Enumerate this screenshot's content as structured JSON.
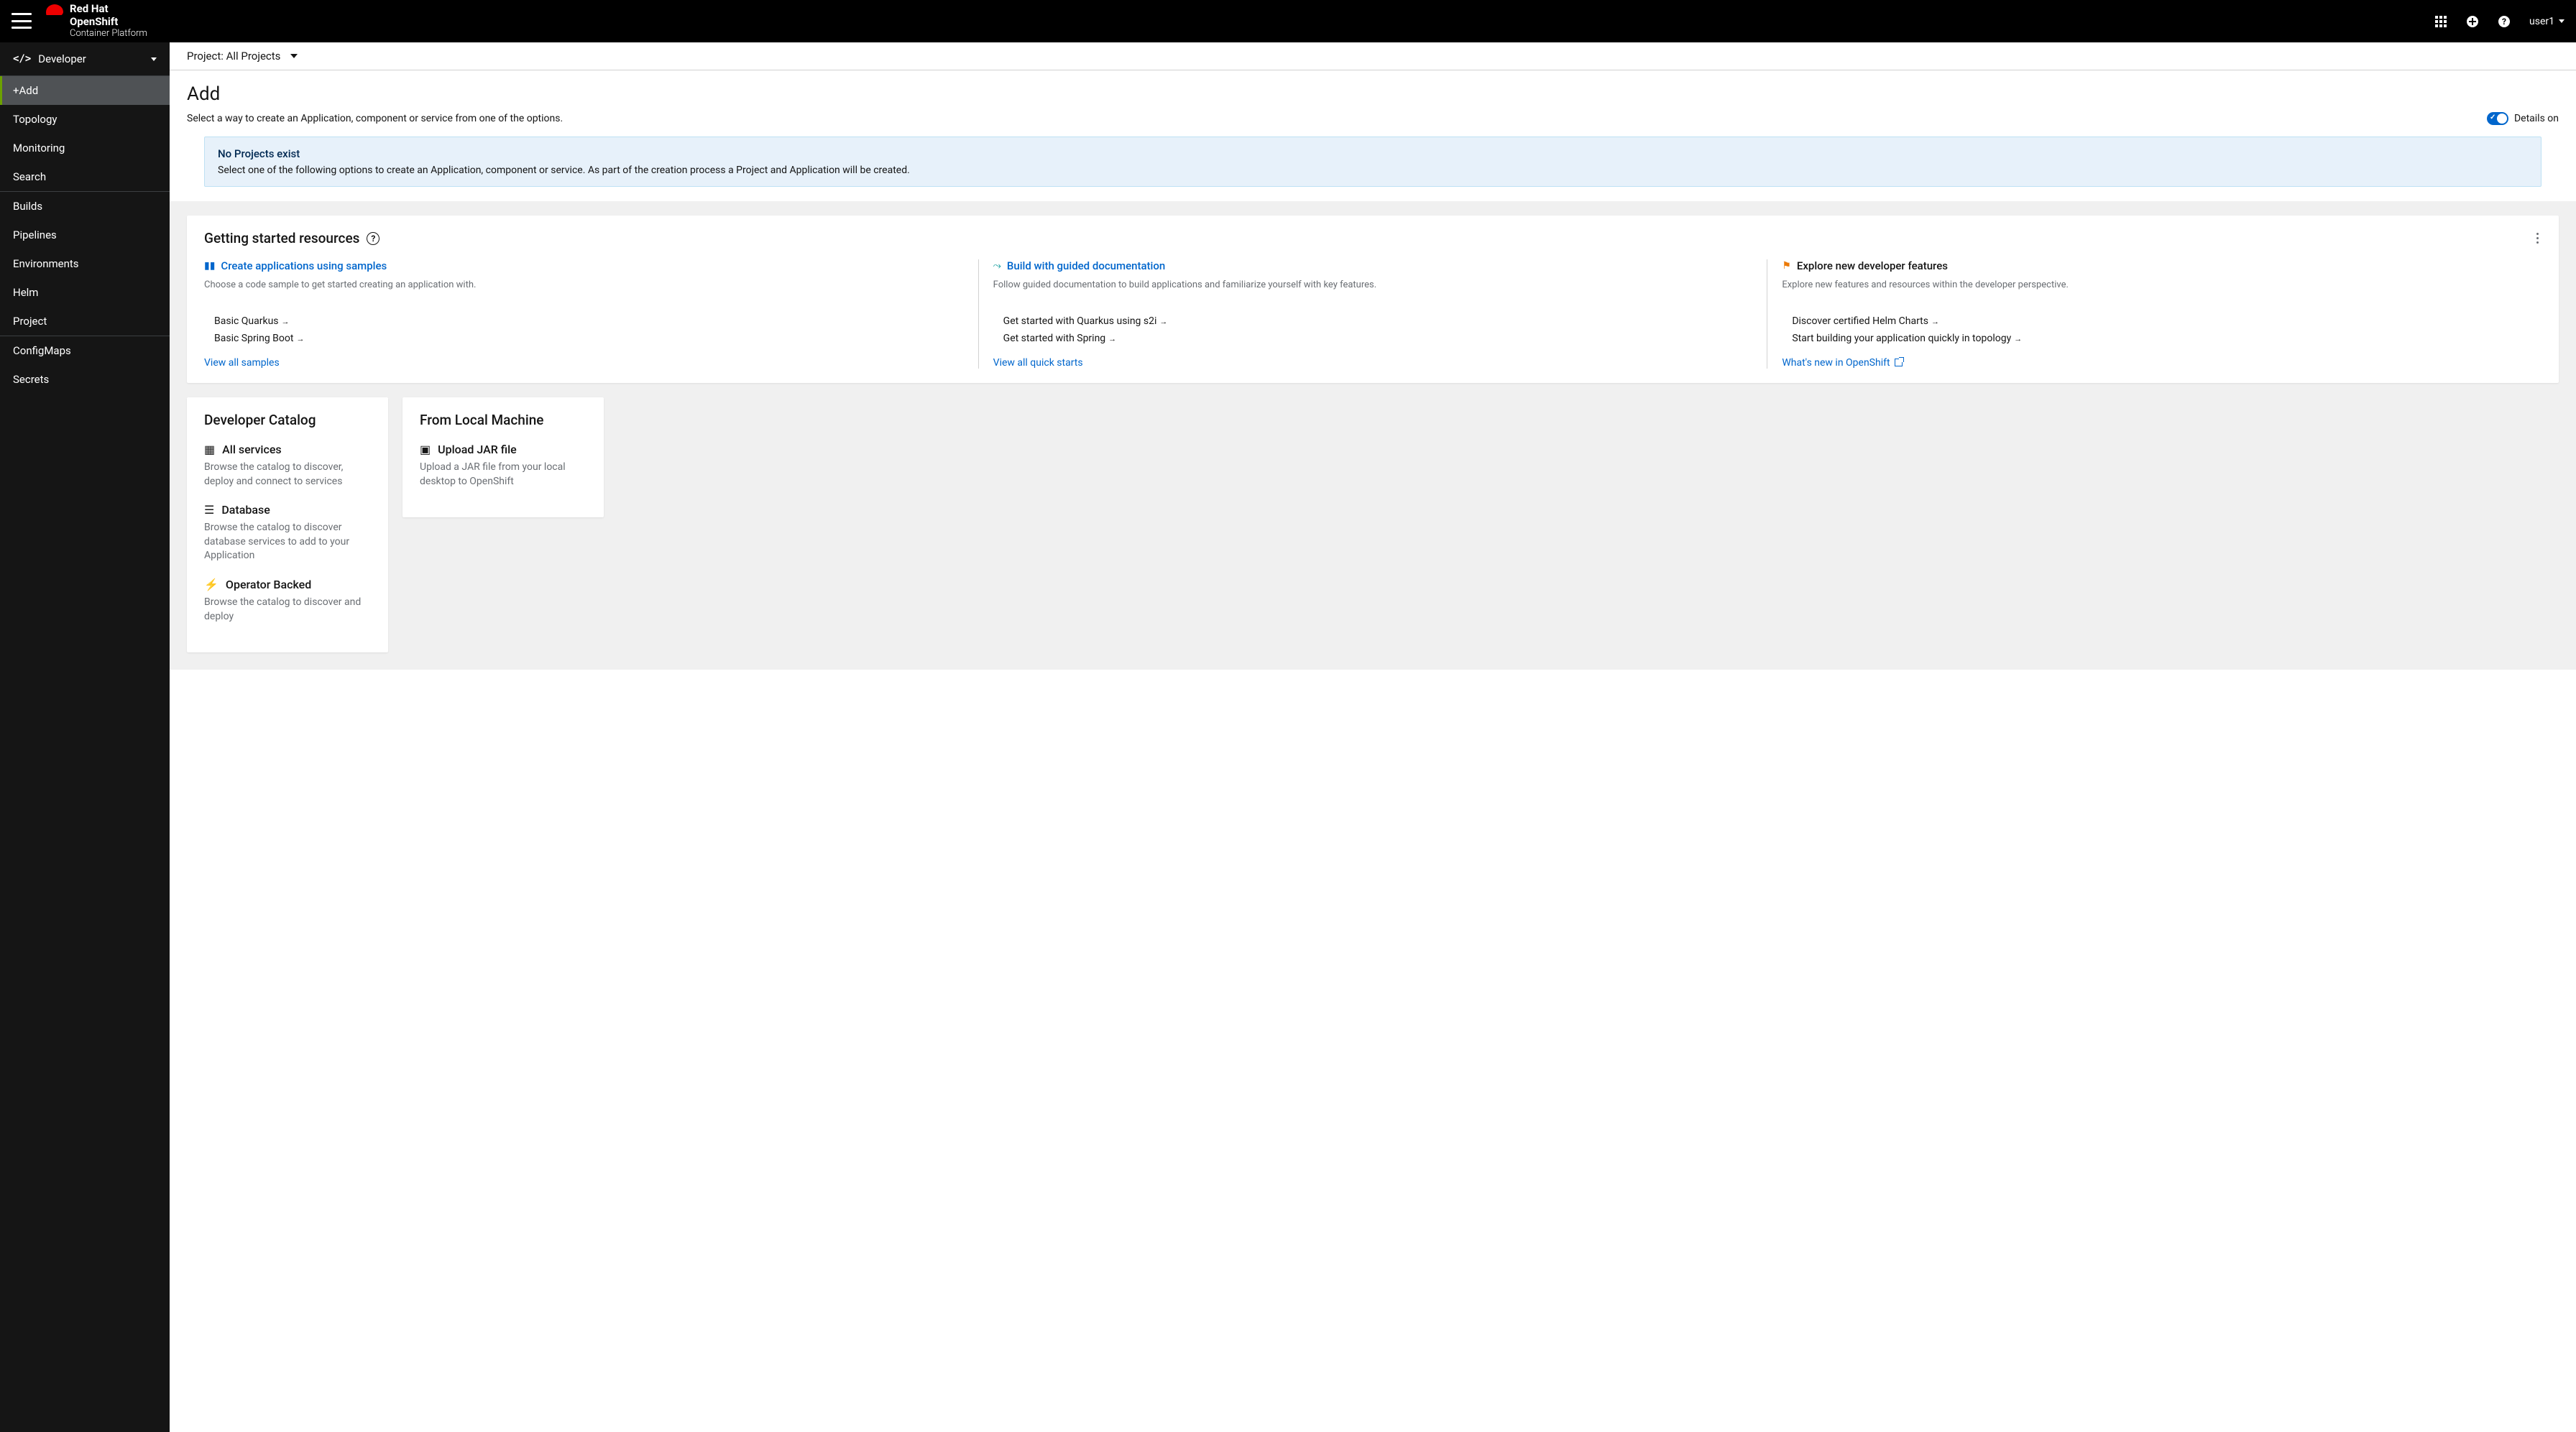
{
  "brand": {
    "line1": "Red Hat",
    "line2": "OpenShift",
    "line3": "Container Platform"
  },
  "user": "user1",
  "perspective": "Developer",
  "nav": {
    "group1": [
      "+Add",
      "Topology",
      "Monitoring",
      "Search"
    ],
    "group2": [
      "Builds",
      "Pipelines",
      "Environments",
      "Helm",
      "Project"
    ],
    "group3": [
      "ConfigMaps",
      "Secrets"
    ]
  },
  "project_selector": "Project: All Projects",
  "page": {
    "title": "Add",
    "subtitle": "Select a way to create an Application, component or service from one of the options."
  },
  "details_label": "Details on",
  "alert": {
    "title": "No Projects exist",
    "body": "Select one of the following options to create an Application, component or service. As part of the creation process a Project and Application will be created."
  },
  "gsr": {
    "title": "Getting started resources",
    "cols": [
      {
        "title": "Create applications using samples",
        "desc": "Choose a code sample to get started creating an application with.",
        "links": [
          "Basic Quarkus",
          "Basic Spring Boot"
        ],
        "viewall": "View all samples"
      },
      {
        "title": "Build with guided documentation",
        "desc": "Follow guided documentation to build applications and familiarize yourself with key features.",
        "links": [
          "Get started with Quarkus using s2i",
          "Get started with Spring"
        ],
        "viewall": "View all quick starts"
      },
      {
        "title": "Explore new developer features",
        "desc": "Explore new features and resources within the developer perspective.",
        "links": [
          "Discover certified Helm Charts",
          "Start building your application quickly in topology"
        ],
        "viewall": "What's new in OpenShift"
      }
    ]
  },
  "catalog": {
    "title": "Developer Catalog",
    "items": [
      {
        "name": "All services",
        "desc": "Browse the catalog to discover, deploy and connect to services"
      },
      {
        "name": "Database",
        "desc": "Browse the catalog to discover database services to add to your Application"
      },
      {
        "name": "Operator Backed",
        "desc": "Browse the catalog to discover and deploy"
      }
    ]
  },
  "local": {
    "title": "From Local Machine",
    "items": [
      {
        "name": "Upload JAR file",
        "desc": "Upload a JAR file from your local desktop to OpenShift"
      }
    ]
  }
}
